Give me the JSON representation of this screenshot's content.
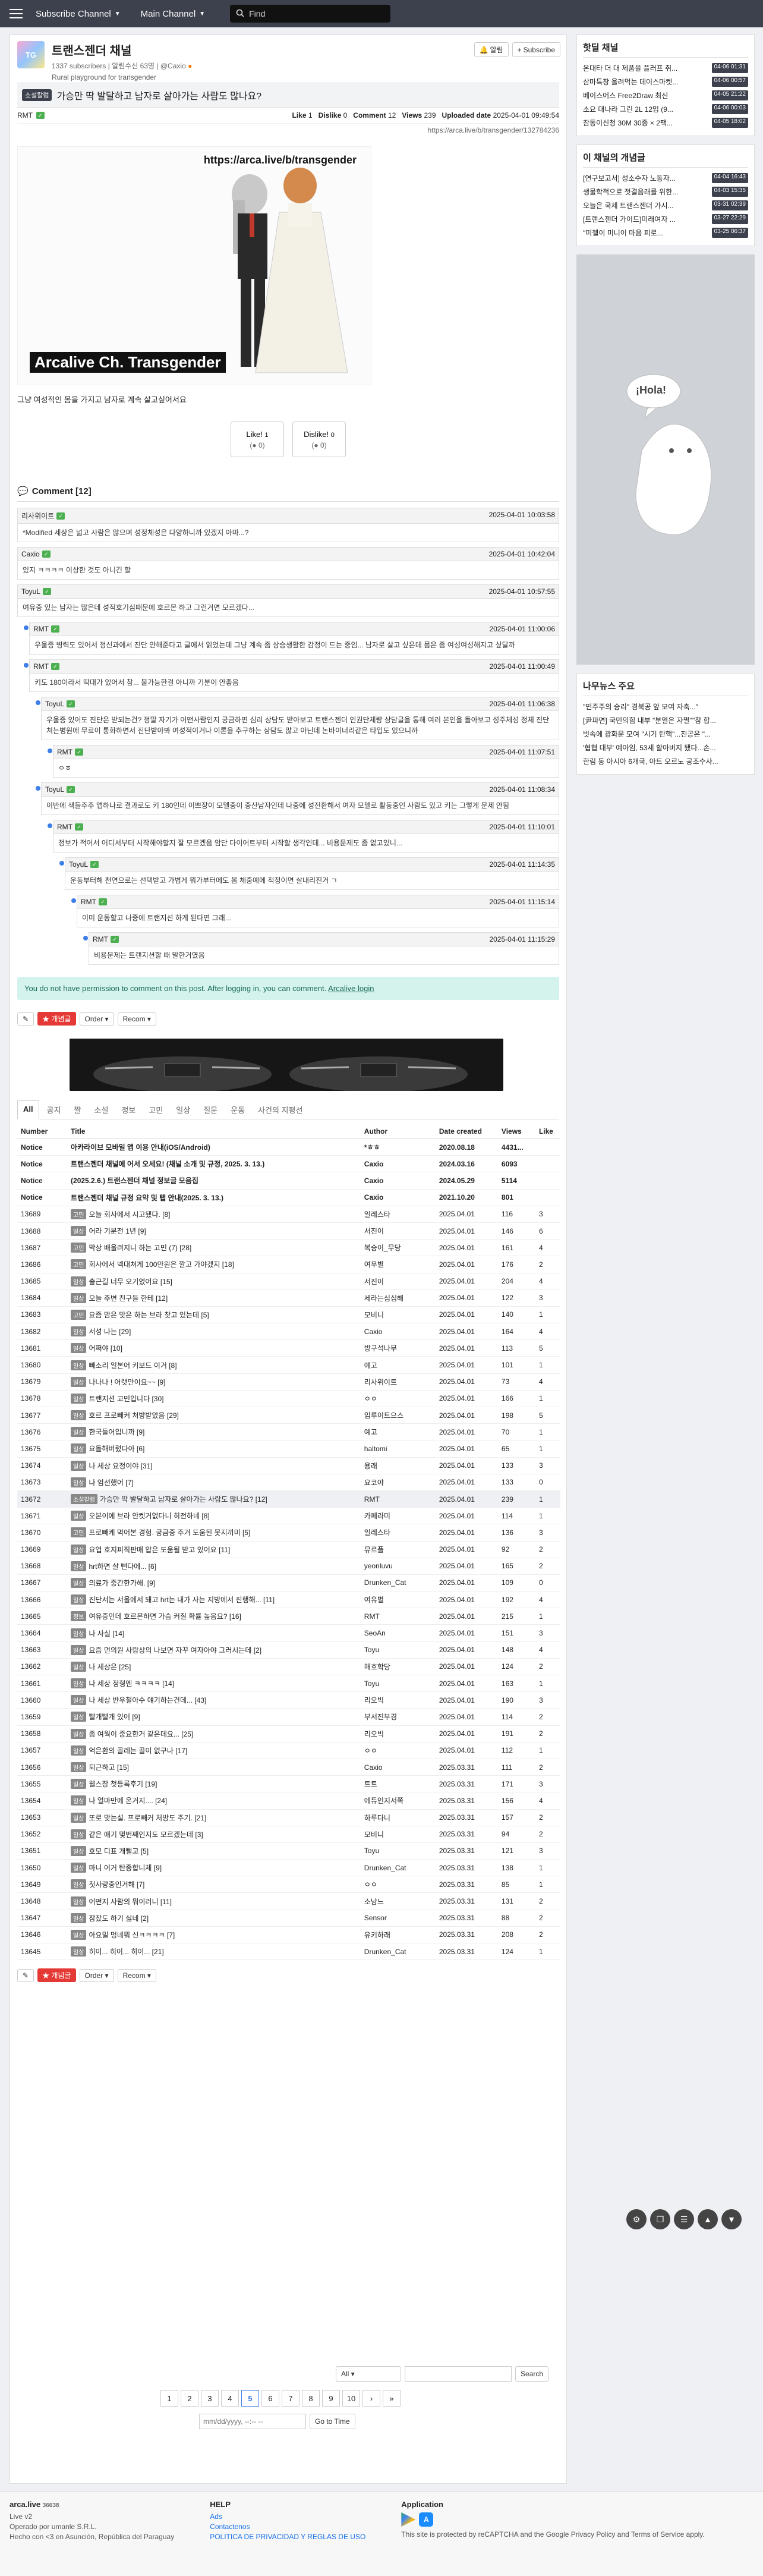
{
  "topbar": {
    "subscribe_channel": "Subscribe Channel",
    "main_channel": "Main Channel",
    "search_placeholder": "Find"
  },
  "channel": {
    "name": "트랜스젠더 채널",
    "subscribers": "1337 subscribers",
    "notifications": "알림수신 63명",
    "owner": "@Caxio",
    "description": "Rural playground for transgender",
    "notify_label": "알림",
    "subscribe_label": "Subscribe"
  },
  "post": {
    "category": "소설칼럼",
    "title": "가승만 딱 발달하고 남자로 살아가는 사람도 많나요?",
    "author": "RMT",
    "like_label": "Like",
    "like": "1",
    "dislike_label": "Dislike",
    "dislike": "0",
    "comment_label": "Comment",
    "comment": "12",
    "views_label": "Views",
    "views": "239",
    "uploaded_label": "Uploaded date",
    "uploaded": "2025-04-01 09:49:54",
    "url": "https://arca.live/b/transgender/132784236",
    "image_url_text": "https://arca.live/b/transgender",
    "image_watermark": "Arcalive Ch. Transgender",
    "body": "그냥 여성적인 몸을 가지고 남자로 계속 살고싶어서요",
    "like_btn": "Like!",
    "like_btn_count": "1",
    "like_btn_sub": "0",
    "dislike_btn": "Dislike!",
    "dislike_btn_count": "0",
    "dislike_btn_sub": "0"
  },
  "comments_header": "Comment [12]",
  "comments": [
    {
      "author": "리사위이트",
      "date": "2025-04-01 10:03:58",
      "text": "*Modified 세상은 넓고 사람은 많으며 성정체성은 다양하니까 있겠지 아마...?",
      "depth": 0
    },
    {
      "author": "Caxio",
      "date": "2025-04-01 10:42:04",
      "text": "있지 ㅋㅋㅋㅋ 이상한 것도 아니긴 할",
      "depth": 0
    },
    {
      "author": "ToyuL",
      "date": "2025-04-01 10:57:55",
      "text": "여유증 있는 남자는 많은데 성적호기심때문에 호르몬 하고 그런거면 모르겠다...",
      "depth": 0
    },
    {
      "author": "RMT",
      "date": "2025-04-01 11:00:06",
      "text": "우울증 병력도 있어서 정신과에서 진단 안해준다고 글에서 읽었는데 그냥 계속 좀 상승생활한 감정이 드는 중임... 남자로 살고 싶은데 몸은 좀 여성여성해지고 싶달까",
      "depth": 1
    },
    {
      "author": "RMT",
      "date": "2025-04-01 11:00:49",
      "text": "키도 180이라서 딱대가 있어서 참... 불가능한걸 아니까 기분이 안좋음",
      "depth": 1
    },
    {
      "author": "ToyuL",
      "date": "2025-04-01 11:06:38",
      "text": "우울증 있어도 진단은 받되는건? 정말 자기가 어떤사람인지 궁금하면 심리 상담도 받아보고 트랜스젠더 인권단체랑 상담글을 통해 여러 본인을 돌아보고 성주체성 정체 진단처는병원에 무료이 통화하면서 진단받아봐 여성적이거나 이론을 추구하는 상담도 많고 아닌데 논바이너리같은 타입도 있으니까",
      "depth": 2
    },
    {
      "author": "RMT",
      "date": "2025-04-01 11:07:51",
      "text": "ㅇㅎ",
      "depth": 3
    },
    {
      "author": "ToyuL",
      "date": "2025-04-01 11:08:34",
      "text": "이반에 색들주주 앱하나로 결과로도 키 180인데 이쁘장이 모델중이 중산남자인데 나중에 성전환해서 여자 모델로 활동중인 사람도 있고 키는 그렇게 문제 안됨",
      "depth": 2
    },
    {
      "author": "RMT",
      "date": "2025-04-01 11:10:01",
      "text": "정보가 적어서 어디서부터 시작해야할지 잘 모르겠음 암단 다이어트부터 시작할 생각인데... 비용문제도 좀 없고있니...",
      "depth": 3
    },
    {
      "author": "ToyuL",
      "date": "2025-04-01 11:14:35",
      "text": "운동부터해 천연으로는 선택받고 가볍게 뭐가부터에도 봄 체중예에 적정이면 살내리진거 ㄱ",
      "depth": 4
    },
    {
      "author": "RMT",
      "date": "2025-04-01 11:15:14",
      "text": "이미 운동할고 나중에 트랜지션 하게 된다면 그래...",
      "depth": 5
    },
    {
      "author": "RMT",
      "date": "2025-04-01 11:15:29",
      "text": "비용문제는 트랜지션할 때 말한거였음",
      "depth": 6
    }
  ],
  "no_permission": {
    "text": "You do not have permission to comment on this post. After logging in, you can comment.",
    "link": "Arcalive login"
  },
  "toolbar": {
    "pencil": "✎",
    "best": "개념글",
    "order": "Order",
    "recom": "Recom"
  },
  "tabs": [
    "All",
    "공지",
    "짤",
    "소설",
    "정보",
    "고민",
    "일상",
    "질문",
    "운동",
    "사건의 지평선"
  ],
  "table_headers": {
    "number": "Number",
    "title": "Title",
    "author": "Author",
    "date": "Date created",
    "views": "Views",
    "like": "Like"
  },
  "rows": [
    {
      "num": "Notice",
      "cat": "",
      "title": "아카라이브 모바일 앱 이용 안내(iOS/Android)",
      "author": "*ㅎㅎ",
      "date": "2020.08.18",
      "views": "4431...",
      "like": "",
      "notice": true
    },
    {
      "num": "Notice",
      "cat": "",
      "title": "트랜스젠더 채널에 어서 오세요! (채널 소개 및 규정, 2025. 3. 13.)",
      "author": "Caxio",
      "date": "2024.03.16",
      "views": "6093",
      "like": "",
      "notice": true
    },
    {
      "num": "Notice",
      "cat": "",
      "title": "(2025.2.6.) 트랜스젠더 채널 정보글 모음집",
      "author": "Caxio",
      "date": "2024.05.29",
      "views": "5114",
      "like": "",
      "notice": true
    },
    {
      "num": "Notice",
      "cat": "",
      "title": "트랜스젠더 채널 규정 요약 및 탭 안내(2025. 3. 13.)",
      "author": "Caxio",
      "date": "2021.10.20",
      "views": "801",
      "like": "",
      "notice": true
    },
    {
      "num": "13689",
      "cat": "고민",
      "title": "오늘 회사에서 시고됐다. [8]",
      "author": "일레스타",
      "date": "2025.04.01",
      "views": "116",
      "like": "3"
    },
    {
      "num": "13688",
      "cat": "일상",
      "title": "어라 기분전 1년 [9]",
      "author": "서진이",
      "date": "2025.04.01",
      "views": "146",
      "like": "6"
    },
    {
      "num": "13687",
      "cat": "고민",
      "title": "막상 배울려지니 하는 고민 (7) [28]",
      "author": "복승이_무당",
      "date": "2025.04.01",
      "views": "161",
      "like": "4"
    },
    {
      "num": "13686",
      "cat": "고민",
      "title": "회사에서 넥대쳐게 100만원은 깔고 가야겠지 [18]",
      "author": "여우별",
      "date": "2025.04.01",
      "views": "176",
      "like": "2"
    },
    {
      "num": "13685",
      "cat": "일상",
      "title": "출근길 너무 오기였어요 [15]",
      "author": "서진이",
      "date": "2025.04.01",
      "views": "204",
      "like": "4"
    },
    {
      "num": "13684",
      "cat": "일상",
      "title": "오늘 주변 친구들 한테 [12]",
      "author": "세라는심심해",
      "date": "2025.04.01",
      "views": "122",
      "like": "3"
    },
    {
      "num": "13683",
      "cat": "고민",
      "title": "요즘 맘은 맞은 하는 브라 찾고 있는데 [5]",
      "author": "모비니",
      "date": "2025.04.01",
      "views": "140",
      "like": "1"
    },
    {
      "num": "13682",
      "cat": "일상",
      "title": "서성 나는 [29]",
      "author": "Caxio",
      "date": "2025.04.01",
      "views": "164",
      "like": "4"
    },
    {
      "num": "13681",
      "cat": "일상",
      "title": "어쩌야 [10]",
      "author": "방구석나무",
      "date": "2025.04.01",
      "views": "113",
      "like": "5"
    },
    {
      "num": "13680",
      "cat": "일상",
      "title": "빼소리 일본어 키보드 이거 [8]",
      "author": "예고",
      "date": "2025.04.01",
      "views": "101",
      "like": "1"
    },
    {
      "num": "13679",
      "cat": "일상",
      "title": "나나나 ! 어랫만이요~~ [9]",
      "author": "리사위이트",
      "date": "2025.04.01",
      "views": "73",
      "like": "4"
    },
    {
      "num": "13678",
      "cat": "일상",
      "title": "트랜지션 고민입니다 [30]",
      "author": "ㅇㅇ",
      "date": "2025.04.01",
      "views": "166",
      "like": "1"
    },
    {
      "num": "13677",
      "cat": "일상",
      "title": "호르 프로빼커 처방받았음 [29]",
      "author": "임루이트으스",
      "date": "2025.04.01",
      "views": "198",
      "like": "5"
    },
    {
      "num": "13676",
      "cat": "일상",
      "title": "한국들어입니까 [9]",
      "author": "예고",
      "date": "2025.04.01",
      "views": "70",
      "like": "1"
    },
    {
      "num": "13675",
      "cat": "일상",
      "title": "요돌해버렸다아 [6]",
      "author": "haltomi",
      "date": "2025.04.01",
      "views": "65",
      "like": "1"
    },
    {
      "num": "13674",
      "cat": "일상",
      "title": "나 세상 요정이야 [31]",
      "author": "용래",
      "date": "2025.04.01",
      "views": "133",
      "like": "3"
    },
    {
      "num": "13673",
      "cat": "일상",
      "title": "나 엄선했어 [7]",
      "author": "요코야",
      "date": "2025.04.01",
      "views": "133",
      "like": "0"
    },
    {
      "num": "13672",
      "cat": "소설칼럼",
      "title": "가승만 딱 발달하고 남자로 살아가는 사람도 많나요? [12]",
      "author": "RMT",
      "date": "2025.04.01",
      "views": "239",
      "like": "1",
      "current": true
    },
    {
      "num": "13671",
      "cat": "일상",
      "title": "오본이에 브라 안켓거없다니 히전하네 [8]",
      "author": "카페라미",
      "date": "2025.04.01",
      "views": "114",
      "like": "1"
    },
    {
      "num": "13670",
      "cat": "고민",
      "title": "프로빼케 먹어본 경험. 궁금증 주거 도움된 못지끼미 [5]",
      "author": "일레스타",
      "date": "2025.04.01",
      "views": "136",
      "like": "3"
    },
    {
      "num": "13669",
      "cat": "일상",
      "title": "요업 호지피직판매 압은 도움될 받고 있어요 [11]",
      "author": "뮤르플",
      "date": "2025.04.01",
      "views": "92",
      "like": "2"
    },
    {
      "num": "13668",
      "cat": "일상",
      "title": "hrt하면 살 뻔다에... [6]",
      "author": "yeonluvu",
      "date": "2025.04.01",
      "views": "165",
      "like": "2"
    },
    {
      "num": "13667",
      "cat": "일상",
      "title": "의료가 중간한가해. [9]",
      "author": "Drunken_Cat",
      "date": "2025.04.01",
      "views": "109",
      "like": "0"
    },
    {
      "num": "13666",
      "cat": "일상",
      "title": "진단서는 서울에서 돼고 hrt는 내가 사는 지방에서 진행해... [11]",
      "author": "여유별",
      "date": "2025.04.01",
      "views": "192",
      "like": "4"
    },
    {
      "num": "13665",
      "cat": "정보",
      "title": "여유증인데 호르몬하면 가슴 커질 확률 높음요? [16]",
      "author": "RMT",
      "date": "2025.04.01",
      "views": "215",
      "like": "1"
    },
    {
      "num": "13664",
      "cat": "일상",
      "title": "나 사실 [14]",
      "author": "SeoAn",
      "date": "2025.04.01",
      "views": "151",
      "like": "3"
    },
    {
      "num": "13663",
      "cat": "일상",
      "title": "요즘 먼의원 사람상의 나보면 자꾸 여자아야 그러시는데 [2]",
      "author": "Toyu",
      "date": "2025.04.01",
      "views": "148",
      "like": "4"
    },
    {
      "num": "13662",
      "cat": "일상",
      "title": "나 세상은 [25]",
      "author": "해호학당",
      "date": "2025.04.01",
      "views": "124",
      "like": "2"
    },
    {
      "num": "13661",
      "cat": "일상",
      "title": "나 세상 정형엔 ㅋㅋㅋㅋ [14]",
      "author": "Toyu",
      "date": "2025.04.01",
      "views": "163",
      "like": "1"
    },
    {
      "num": "13660",
      "cat": "일상",
      "title": "나 세상 반우철아수 얘기하는건데... [43]",
      "author": "리오빅",
      "date": "2025.04.01",
      "views": "190",
      "like": "3"
    },
    {
      "num": "13659",
      "cat": "일상",
      "title": "빨개빨개 있어 [9]",
      "author": "부서진부경",
      "date": "2025.04.01",
      "views": "114",
      "like": "2"
    },
    {
      "num": "13658",
      "cat": "일상",
      "title": "좀 여웍이 중요한거 같은데요... [25]",
      "author": "리오빅",
      "date": "2025.04.01",
      "views": "191",
      "like": "2"
    },
    {
      "num": "13657",
      "cat": "일상",
      "title": "억은환의 골레는 골이 없구나 [17]",
      "author": "ㅇㅇ",
      "date": "2025.04.01",
      "views": "112",
      "like": "1"
    },
    {
      "num": "13656",
      "cat": "일상",
      "title": "퇴근하고 [15]",
      "author": "Caxio",
      "date": "2025.03.31",
      "views": "111",
      "like": "2"
    },
    {
      "num": "13655",
      "cat": "일상",
      "title": "웰스장 첫등록후기 [19]",
      "author": "트트",
      "date": "2025.03.31",
      "views": "171",
      "like": "3"
    },
    {
      "num": "13654",
      "cat": "일상",
      "title": "나 얼마만에 온거지.... [24]",
      "author": "에듀인지서쪽",
      "date": "2025.03.31",
      "views": "156",
      "like": "4"
    },
    {
      "num": "13653",
      "cat": "일상",
      "title": "또로 맞는설. 프로빼커 처방도 주기. [21]",
      "author": "하루다니",
      "date": "2025.03.31",
      "views": "157",
      "like": "2"
    },
    {
      "num": "13652",
      "cat": "일상",
      "title": "같은 애기 몇번째인지도 모르겠는데 [3]",
      "author": "모비니",
      "date": "2025.03.31",
      "views": "94",
      "like": "2"
    },
    {
      "num": "13651",
      "cat": "일상",
      "title": "호모 디표 개뻘고 [5]",
      "author": "Toyu",
      "date": "2025.03.31",
      "views": "121",
      "like": "3"
    },
    {
      "num": "13650",
      "cat": "일상",
      "title": "마니 어거 탄종합니체 [9]",
      "author": "Drunken_Cat",
      "date": "2025.03.31",
      "views": "138",
      "like": "1"
    },
    {
      "num": "13649",
      "cat": "일상",
      "title": "첫사랑중인거해 [7]",
      "author": "ㅇㅇ",
      "date": "2025.03.31",
      "views": "85",
      "like": "1"
    },
    {
      "num": "13648",
      "cat": "일상",
      "title": "어떤지 사람의 뭐이러니 [11]",
      "author": "소낭느",
      "date": "2025.03.31",
      "views": "131",
      "like": "2"
    },
    {
      "num": "13647",
      "cat": "일상",
      "title": "잠잤도 하기 싫네 [2]",
      "author": "Sensor",
      "date": "2025.03.31",
      "views": "88",
      "like": "2"
    },
    {
      "num": "13646",
      "cat": "일상",
      "title": "아요밀 멍네뭐 신ㅋㅋㅋㅋ [7]",
      "author": "유키하래",
      "date": "2025.03.31",
      "views": "208",
      "like": "2"
    },
    {
      "num": "13645",
      "cat": "일상",
      "title": "히이... 히이... 히이... [21]",
      "author": "Drunken_Cat",
      "date": "2025.03.31",
      "views": "124",
      "like": "1"
    }
  ],
  "bottom": {
    "select_all": "All",
    "search_btn": "Search",
    "pages": [
      "1",
      "2",
      "3",
      "4",
      "5",
      "6",
      "7",
      "8",
      "9",
      "10"
    ],
    "next1": "›",
    "next2": "»",
    "date_placeholder": "mm/dd/yyyy, --:-- --",
    "goto": "Go to Time"
  },
  "sidebar": {
    "hot_title": "핫딜 채널",
    "hot_items": [
      {
        "t": "온대타 더 대 제품을 플러프 취...",
        "time": "04-06 01:31"
      },
      {
        "t": "삼마특창 올려먹는 데이스마켓...",
        "time": "04-06 00:57"
      },
      {
        "t": "베이스어스 Free2Draw 최신",
        "time": "04-05 21:22"
      },
      {
        "t": "소요 대나라 그린 2L 12입 (9...",
        "time": "04-06 00:03"
      },
      {
        "t": "참동이신청 30M 30종 × 2팩...",
        "time": "04-05 18:02"
      }
    ],
    "concept_title": "이 채널의 개념글",
    "concept_items": [
      {
        "t": "[연구보고서] 성소수자 노동자...",
        "time": "04-04 16:43"
      },
      {
        "t": "생물학적으로 젓결음래를 위한...",
        "time": "04-03 15:35"
      },
      {
        "t": "오늘은 국제 트랜스젠더 가시...",
        "time": "03-31 02:39"
      },
      {
        "t": "[트랜스젠더 가이드]미래여자 ...",
        "time": "03-27 22:29"
      },
      {
        "t": "\"미첼이 미니이 마음 피로...",
        "time": "03-25 06:37"
      }
    ],
    "ad_text": "¡Hola!",
    "news_title": "나무뉴스 주요",
    "news_items": [
      "\"민주주의 승리\" 경북공 앞 모여 자축...\"",
      "[尹파면] 국민의힘 내부 \"분열은 자멸\"\"참 합...",
      "빗속에 광화문 모여 \"시기 탄핵\"...진공은 \"...",
      "'협협 대부' 예아임, 53세 할아버지 됐다...손...",
      "한림 동 아시아 6개국, 아트 오르노 공조수사..."
    ]
  },
  "footer": {
    "brand": "arca.live",
    "brand_count": "36638",
    "line1": "Live v2",
    "line2": "Operado por umanle S.R.L.",
    "line3": "Hecho con <3 en Asunción, República del Paraguay",
    "help_title": "HELP",
    "help1": "Ads",
    "help2": "Contactenos",
    "help3": "POLITICA DE PRIVACIDAD Y REGLAS DE USO",
    "app_title": "Application",
    "recaptcha": "This site is protected by reCAPTCHA and the Google Privacy Policy and Terms of Service apply."
  },
  "colors": {
    "topbar": "#3d414d",
    "accent": "#3d7ee8",
    "notice_bg": "#d4f3ed",
    "best_red": "#e53935"
  }
}
